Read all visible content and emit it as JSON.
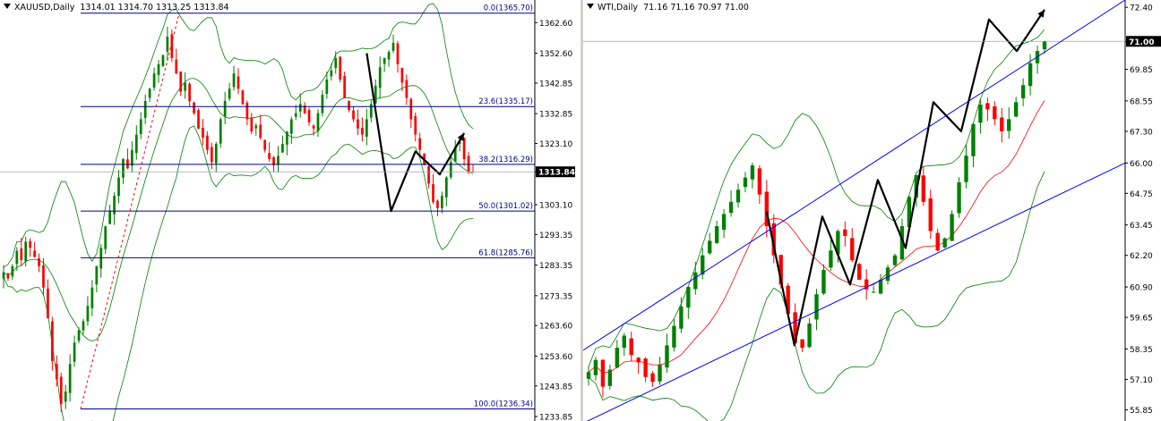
{
  "colors": {
    "bull": "#008000",
    "bear": "#ff0000",
    "bands": "#008000",
    "ma": "#ff0000",
    "fib": "#000080",
    "fib_text": "#00008b",
    "channel": "#0000ff",
    "arrows": "#000000",
    "axis_text": "#000000",
    "price_tag_bg": "#000000",
    "price_tag_fg": "#ffffff"
  },
  "left_chart": {
    "header": {
      "symbol": "XAUUSD,Daily",
      "ohlc": "1314.01 1314.70 1313.25 1313.84"
    },
    "current_price_label": "1313.84",
    "current_price": 1313.84
  },
  "right_chart": {
    "header": {
      "symbol": "WTI,Daily",
      "ohlc": "71.16 71.16 70.97 71.00"
    },
    "current_price_label": "71.00",
    "current_price": 71.0
  },
  "chart_data": [
    {
      "type": "candlestick",
      "symbol": "XAUUSD",
      "timeframe": "Daily",
      "ylim": [
        1233.85,
        1370.0
      ],
      "y_ticks": [
        "1362.60",
        "1352.60",
        "1342.85",
        "1332.85",
        "1323.10",
        "1313.84",
        "1303.10",
        "1293.35",
        "1283.35",
        "1273.35",
        "1263.60",
        "1253.60",
        "1243.85",
        "1233.85"
      ],
      "fibonacci_levels": [
        {
          "label": "0.0(1365.70)",
          "price": 1365.7
        },
        {
          "label": "23.6(1335.17)",
          "price": 1335.17
        },
        {
          "label": "38.2(1316.29)",
          "price": 1316.29
        },
        {
          "label": "50.0(1301.02)",
          "price": 1301.02
        },
        {
          "label": "61.8(1285.76)",
          "price": 1285.76
        },
        {
          "label": "100.0(1236.34)",
          "price": 1236.34
        }
      ],
      "closes_sampled": [
        1281,
        1279,
        1283,
        1288,
        1285,
        1291,
        1289,
        1286,
        1283,
        1276,
        1266,
        1252,
        1246,
        1238,
        1242,
        1251,
        1258,
        1262,
        1265,
        1270,
        1276,
        1283,
        1289,
        1296,
        1301,
        1306,
        1312,
        1318,
        1315,
        1321,
        1326,
        1331,
        1337,
        1341,
        1346,
        1349,
        1352,
        1358,
        1351,
        1346,
        1340,
        1343,
        1337,
        1333,
        1328,
        1325,
        1321,
        1317,
        1323,
        1331,
        1337,
        1341,
        1346,
        1341,
        1336,
        1331,
        1327,
        1329,
        1325,
        1321,
        1318,
        1316,
        1319,
        1323,
        1327,
        1331,
        1333,
        1336,
        1333,
        1330,
        1328,
        1333,
        1339,
        1344,
        1347,
        1351,
        1344,
        1338,
        1334,
        1331,
        1328,
        1326,
        1331,
        1336,
        1342,
        1348,
        1351,
        1353,
        1356,
        1349,
        1343,
        1338,
        1331,
        1326,
        1321,
        1316,
        1310,
        1304,
        1302,
        1306,
        1312,
        1317,
        1322,
        1324,
        1318,
        1314,
        1313.84
      ],
      "pattern_arrow_prices": [
        1352.6,
        1301.0,
        1320.5,
        1313.0,
        1326.5
      ]
    },
    {
      "type": "candlestick",
      "symbol": "WTI",
      "timeframe": "Daily",
      "ylim": [
        55.5,
        72.7
      ],
      "y_ticks": [
        "72.40",
        "71.00",
        "69.85",
        "68.55",
        "67.30",
        "66.00",
        "64.75",
        "63.45",
        "62.20",
        "60.90",
        "59.65",
        "58.35",
        "57.10",
        "55.85"
      ],
      "closes_sampled": [
        57.4,
        57.9,
        56.8,
        57.5,
        58.4,
        58.9,
        58.1,
        57.8,
        57.2,
        57.0,
        57.7,
        58.5,
        59.3,
        60.1,
        60.9,
        61.5,
        62.2,
        62.8,
        63.4,
        63.9,
        64.4,
        64.9,
        65.4,
        65.9,
        64.7,
        63.4,
        62.2,
        61.0,
        59.8,
        58.6,
        58.4,
        59.4,
        60.6,
        61.6,
        62.4,
        63.2,
        63.0,
        62.0,
        61.2,
        60.8,
        60.7,
        61.2,
        61.7,
        62.2,
        63.4,
        64.6,
        65.5,
        64.4,
        63.2,
        62.4,
        62.9,
        63.9,
        65.2,
        66.3,
        67.6,
        68.4,
        68.2,
        67.8,
        67.3,
        67.8,
        68.5,
        69.2,
        70.1,
        70.6,
        71.0
      ],
      "channel_lines": [
        {
          "from_price": 58.3,
          "to_price": 72.7
        },
        {
          "from_price": 55.3,
          "to_price": 66.0
        }
      ],
      "pattern_arrow_prices": [
        64.0,
        58.5,
        63.8,
        61.0,
        65.3,
        62.5,
        68.5,
        67.3,
        71.9,
        70.6,
        72.3
      ]
    }
  ]
}
